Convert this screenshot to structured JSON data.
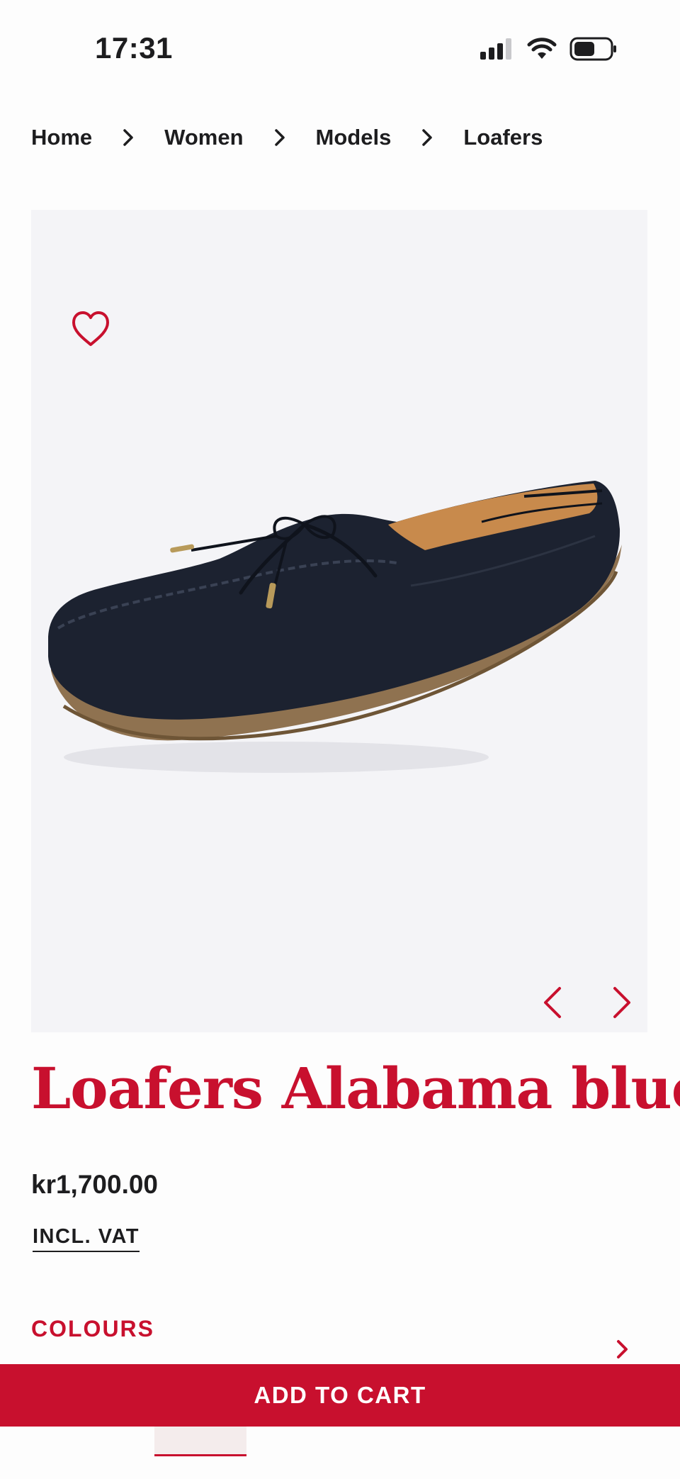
{
  "status_bar": {
    "time": "17:31"
  },
  "breadcrumb": [
    {
      "label": "Home"
    },
    {
      "label": "Women"
    },
    {
      "label": "Models"
    },
    {
      "label": "Loafers"
    }
  ],
  "product": {
    "title": "Loafers Alabama blue",
    "price": "kr1,700.00",
    "vat_label": "INCL. VAT",
    "colour_name": "blue"
  },
  "colours": {
    "label": "COLOURS"
  },
  "cart": {
    "button_label": "ADD TO CART"
  },
  "icons": {
    "wishlist": "heart-icon",
    "prev": "chevron-left-icon",
    "next": "chevron-right-icon",
    "breadcrumb_separator": "chevron-right-icon"
  },
  "colors": {
    "accent": "#c8102e",
    "text": "#1d1d1f",
    "gallery_bg": "#f4f4f7"
  }
}
